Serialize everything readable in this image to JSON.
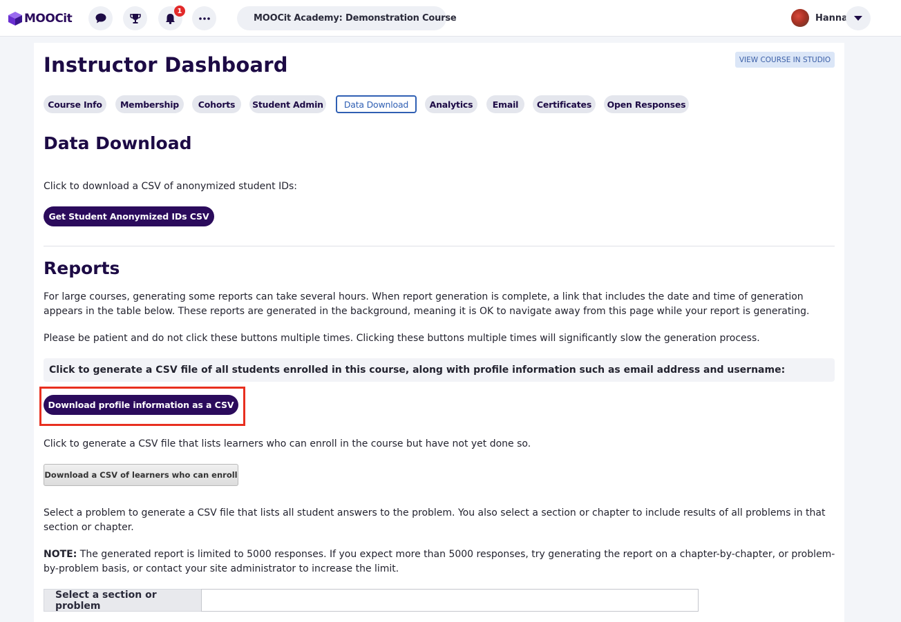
{
  "header": {
    "logo_text": "MOOCit",
    "notification_count": "1",
    "course_title": "MOOCit Academy: Demonstration Course",
    "user_name": "Hanna"
  },
  "page": {
    "title": "Instructor Dashboard",
    "studio_button": "VIEW COURSE IN STUDIO"
  },
  "tabs": [
    {
      "label": "Course Info"
    },
    {
      "label": "Membership"
    },
    {
      "label": "Cohorts"
    },
    {
      "label": "Student Admin"
    },
    {
      "label": "Data Download",
      "active": true
    },
    {
      "label": "Analytics"
    },
    {
      "label": "Email"
    },
    {
      "label": "Certificates"
    },
    {
      "label": "Open Responses"
    }
  ],
  "data_download": {
    "heading": "Data Download",
    "anon_text": "Click to download a CSV of anonymized student IDs:",
    "anon_button": "Get Student Anonymized IDs CSV"
  },
  "reports": {
    "heading": "Reports",
    "intro": "For large courses, generating some reports can take several hours. When report generation is complete, a link that includes the date and time of generation appears in the table below. These reports are generated in the background, meaning it is OK to navigate away from this page while your report is generating.",
    "patience": "Please be patient and do not click these buttons multiple times. Clicking these buttons multiple times will significantly slow the generation process.",
    "profile_callout": "Click to generate a CSV file of all students enrolled in this course, along with profile information such as email address and username:",
    "profile_button": "Download profile information as a CSV",
    "may_enroll_text": "Click to generate a CSV file that lists learners who can enroll in the course but have not yet done so.",
    "may_enroll_button": "Download a CSV of learners who can enroll",
    "problem_text": "Select a problem to generate a CSV file that lists all student answers to the problem. You also select a section or chapter to include results of all problems in that section or chapter.",
    "note_label": "NOTE:",
    "note_text": " The generated report is limited to 5000 responses. If you expect more than 5000 responses, try generating the report on a chapter-by-chapter, or problem-by-problem basis, or contact your site administrator to increase the limit.",
    "select_label": "Select a section or problem",
    "select_value": ""
  },
  "colors": {
    "brand": "#2b0b5c",
    "active_tab": "#2f5fb3",
    "highlight": "#e82f1f",
    "badge": "#e22a2a"
  }
}
